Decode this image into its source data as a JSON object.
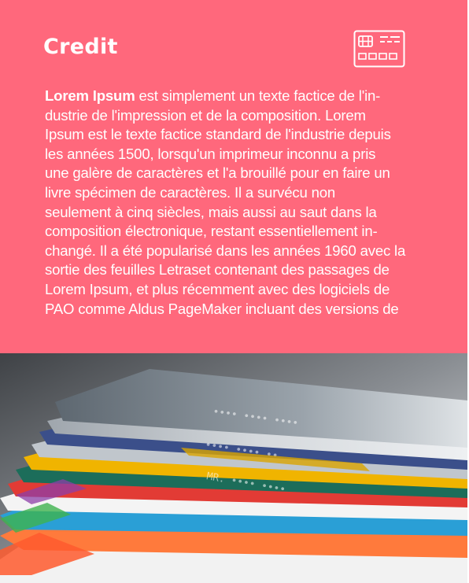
{
  "card": {
    "title": "Credit",
    "icon": "credit-card-icon",
    "body_bold": "Lorem Ipsum",
    "body_lines": [
      " est simplement un texte factice de l'in-",
      "dustrie de l'impression et de la composition. Lorem",
      "Ipsum est le texte factice standard de l'industrie depuis",
      "les années 1500, lorsqu'un imprimeur inconnu a pris",
      "une galère de caractères et l'a brouillé pour en faire un",
      "livre spécimen de caractères. Il a survécu non",
      "seulement à cinq siècles, mais aussi au saut dans la",
      "composition électronique, restant essentiellement in-",
      "changé. Il a été popularisé dans les années 1960 avec la",
      "sortie des feuilles Letraset contenant des passages de",
      "Lorem Ipsum, et plus récemment avec des logiciels de",
      "PAO comme Aldus PageMaker incluant des versions de"
    ],
    "photo": "stacked-credit-cards-photo"
  },
  "colors": {
    "panel": "#ff687c",
    "text": "#ffffff"
  }
}
